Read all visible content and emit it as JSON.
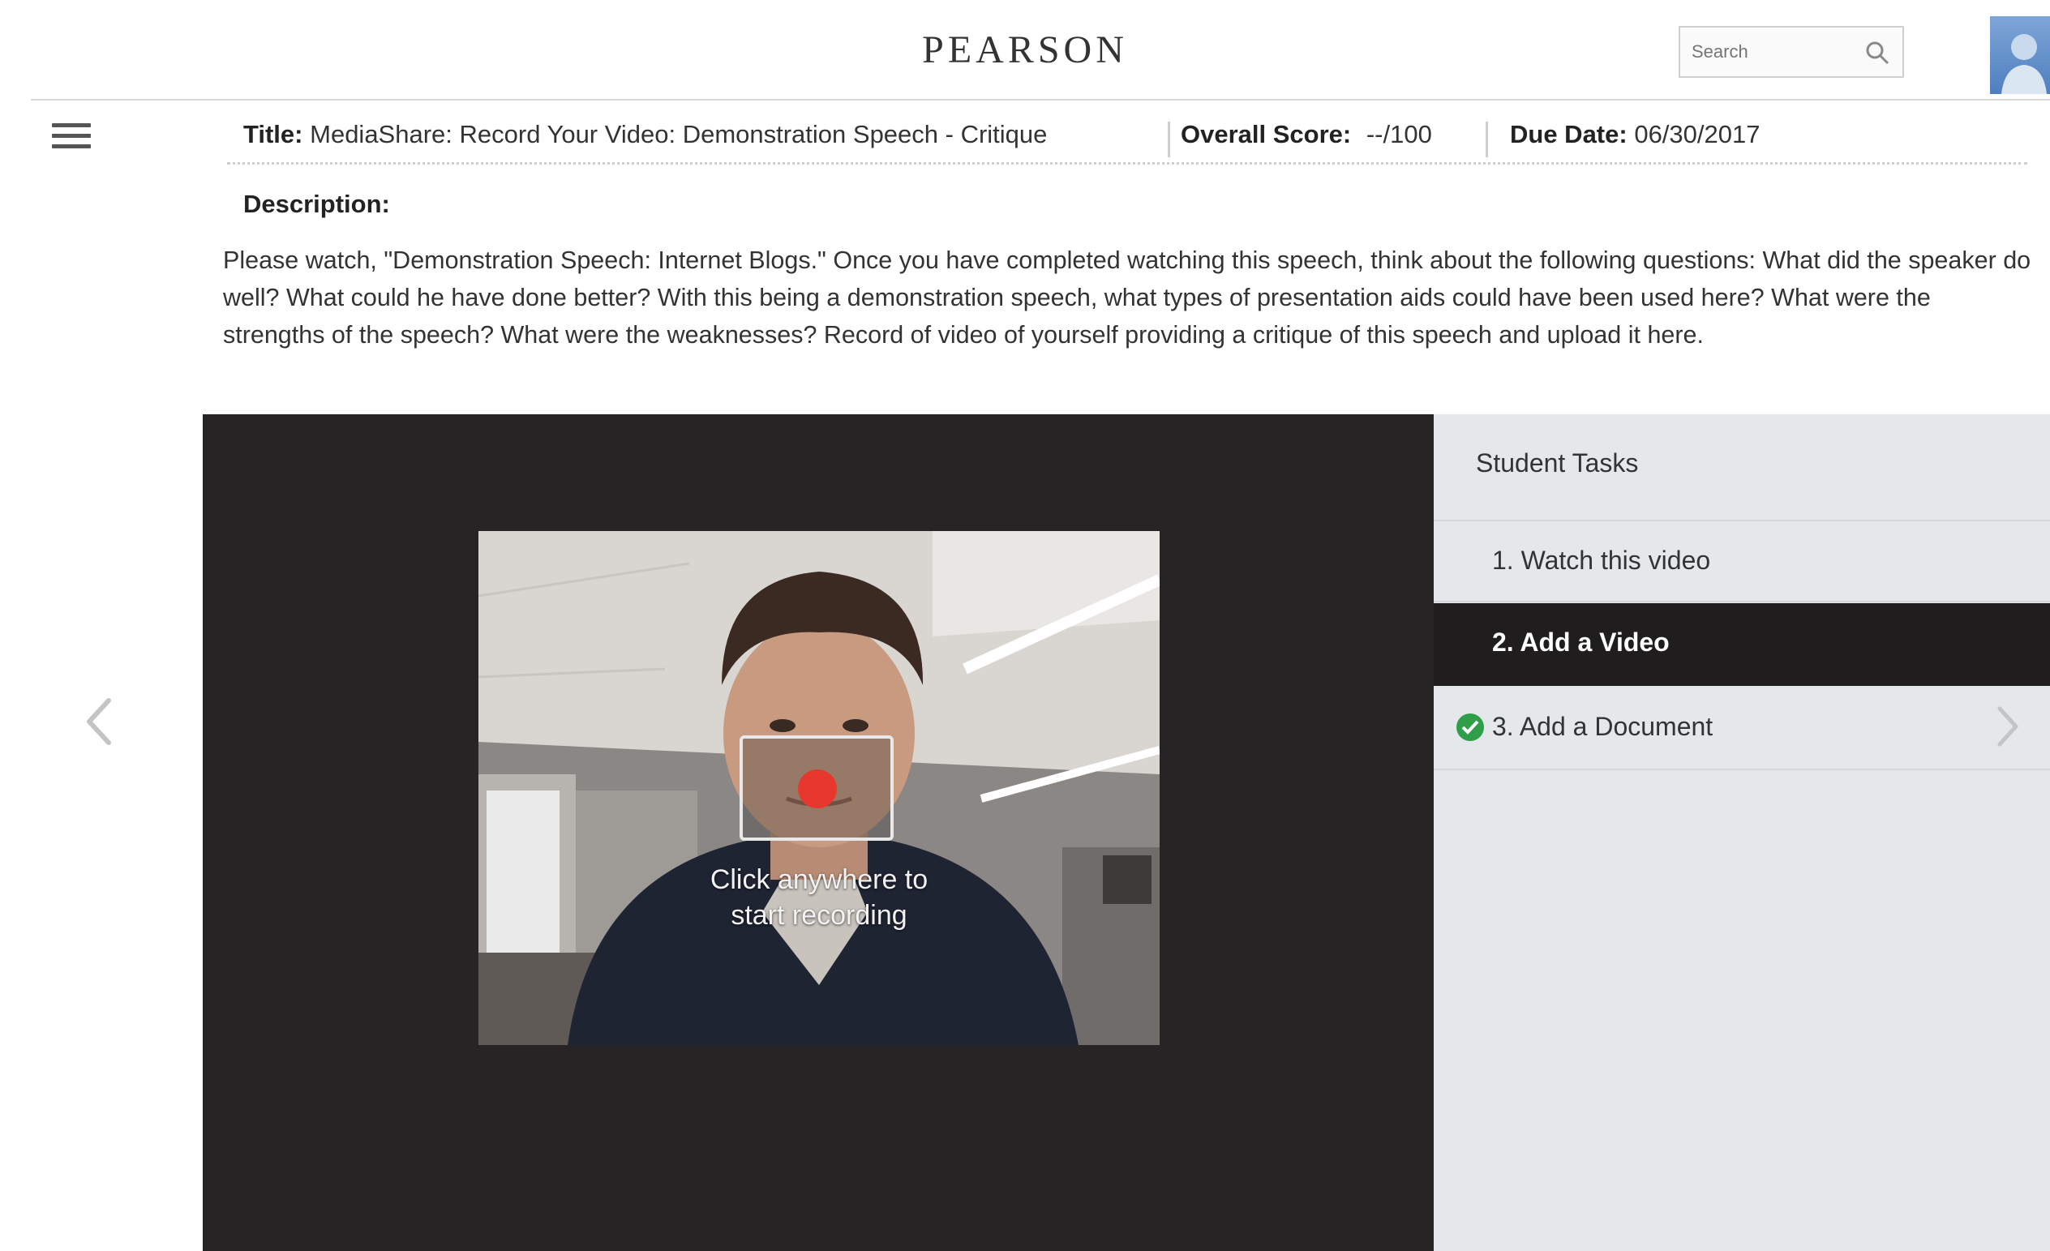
{
  "header": {
    "logo": "PEARSON",
    "search_placeholder": "Search"
  },
  "assignment": {
    "title_label": "Title:",
    "title_value": "MediaShare: Record Your Video: Demonstration Speech - Critique",
    "score_label": "Overall Score:",
    "score_value": "--/100",
    "due_label": "Due Date:",
    "due_value": "06/30/2017",
    "description_label": "Description:",
    "description_text": "Please watch, \"Demonstration Speech: Internet Blogs.\" Once you have completed watching this speech, think about the following questions: What did the speaker do well? What could he have done better? With this being a demonstration speech, what types of presentation aids could have been used here? What were the strengths of the speech? What were the weaknesses? Record of video of yourself providing a critique of this speech and upload it here."
  },
  "recorder": {
    "caption_line1": "Click anywhere to",
    "caption_line2": "start recording",
    "record_color": "#e8382e"
  },
  "tasks": {
    "title": "Student Tasks",
    "items": [
      {
        "label": "1. Watch this video",
        "state": "default"
      },
      {
        "label": "2. Add a Video",
        "state": "active"
      },
      {
        "label": "3. Add a Document",
        "state": "complete"
      }
    ],
    "complete_color": "#2f9e49"
  },
  "icons": {
    "menu": "hamburger-icon",
    "search": "search-icon",
    "prev": "chevron-left-icon",
    "next": "chevron-right-icon",
    "check": "check-circle-icon"
  }
}
